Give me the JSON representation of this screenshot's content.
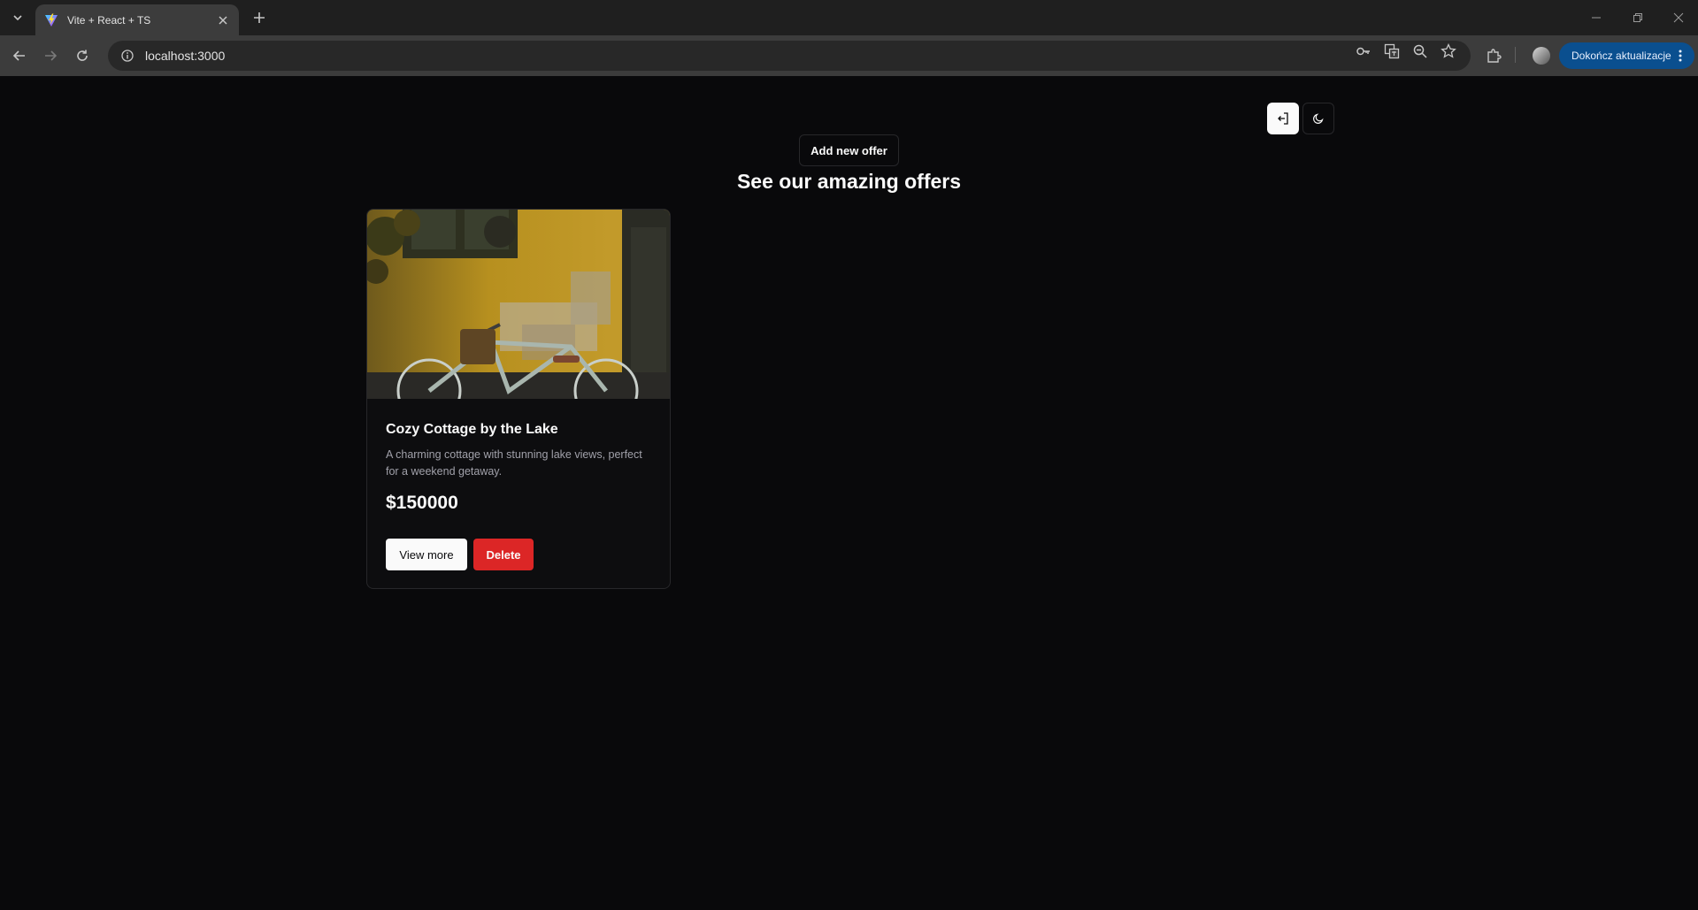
{
  "browser": {
    "tab_title": "Vite + React + TS",
    "url": "localhost:3000",
    "update_button_label": "Dokończ aktualizacje",
    "icons": {
      "tab_search": "chevron-down-icon",
      "favicon": "vite-logo-icon",
      "tab_close": "close-icon",
      "new_tab": "plus-icon",
      "back": "arrow-left-icon",
      "forward": "arrow-right-icon",
      "reload": "reload-icon",
      "site_info": "info-icon",
      "passwords": "key-icon",
      "translate": "translate-icon",
      "zoom": "zoom-out-icon",
      "bookmark": "star-icon",
      "extensions": "puzzle-icon",
      "menu": "kebab-menu-icon"
    }
  },
  "header": {
    "logout_icon": "logout-icon",
    "theme_icon": "moon-icon",
    "add_offer_label": "Add new offer",
    "title": "See our amazing offers"
  },
  "offers": [
    {
      "image_alt": "bicycle against yellow wall",
      "title": "Cozy Cottage by the Lake",
      "description": "A charming cottage with stunning lake views, perfect for a weekend getaway.",
      "price": "$150000",
      "view_label": "View more",
      "delete_label": "Delete"
    }
  ],
  "colors": {
    "background": "#09090b",
    "card": "#0d0d0f",
    "border": "#27272a",
    "delete": "#dc2626",
    "update_button": "#0a4f8f"
  }
}
